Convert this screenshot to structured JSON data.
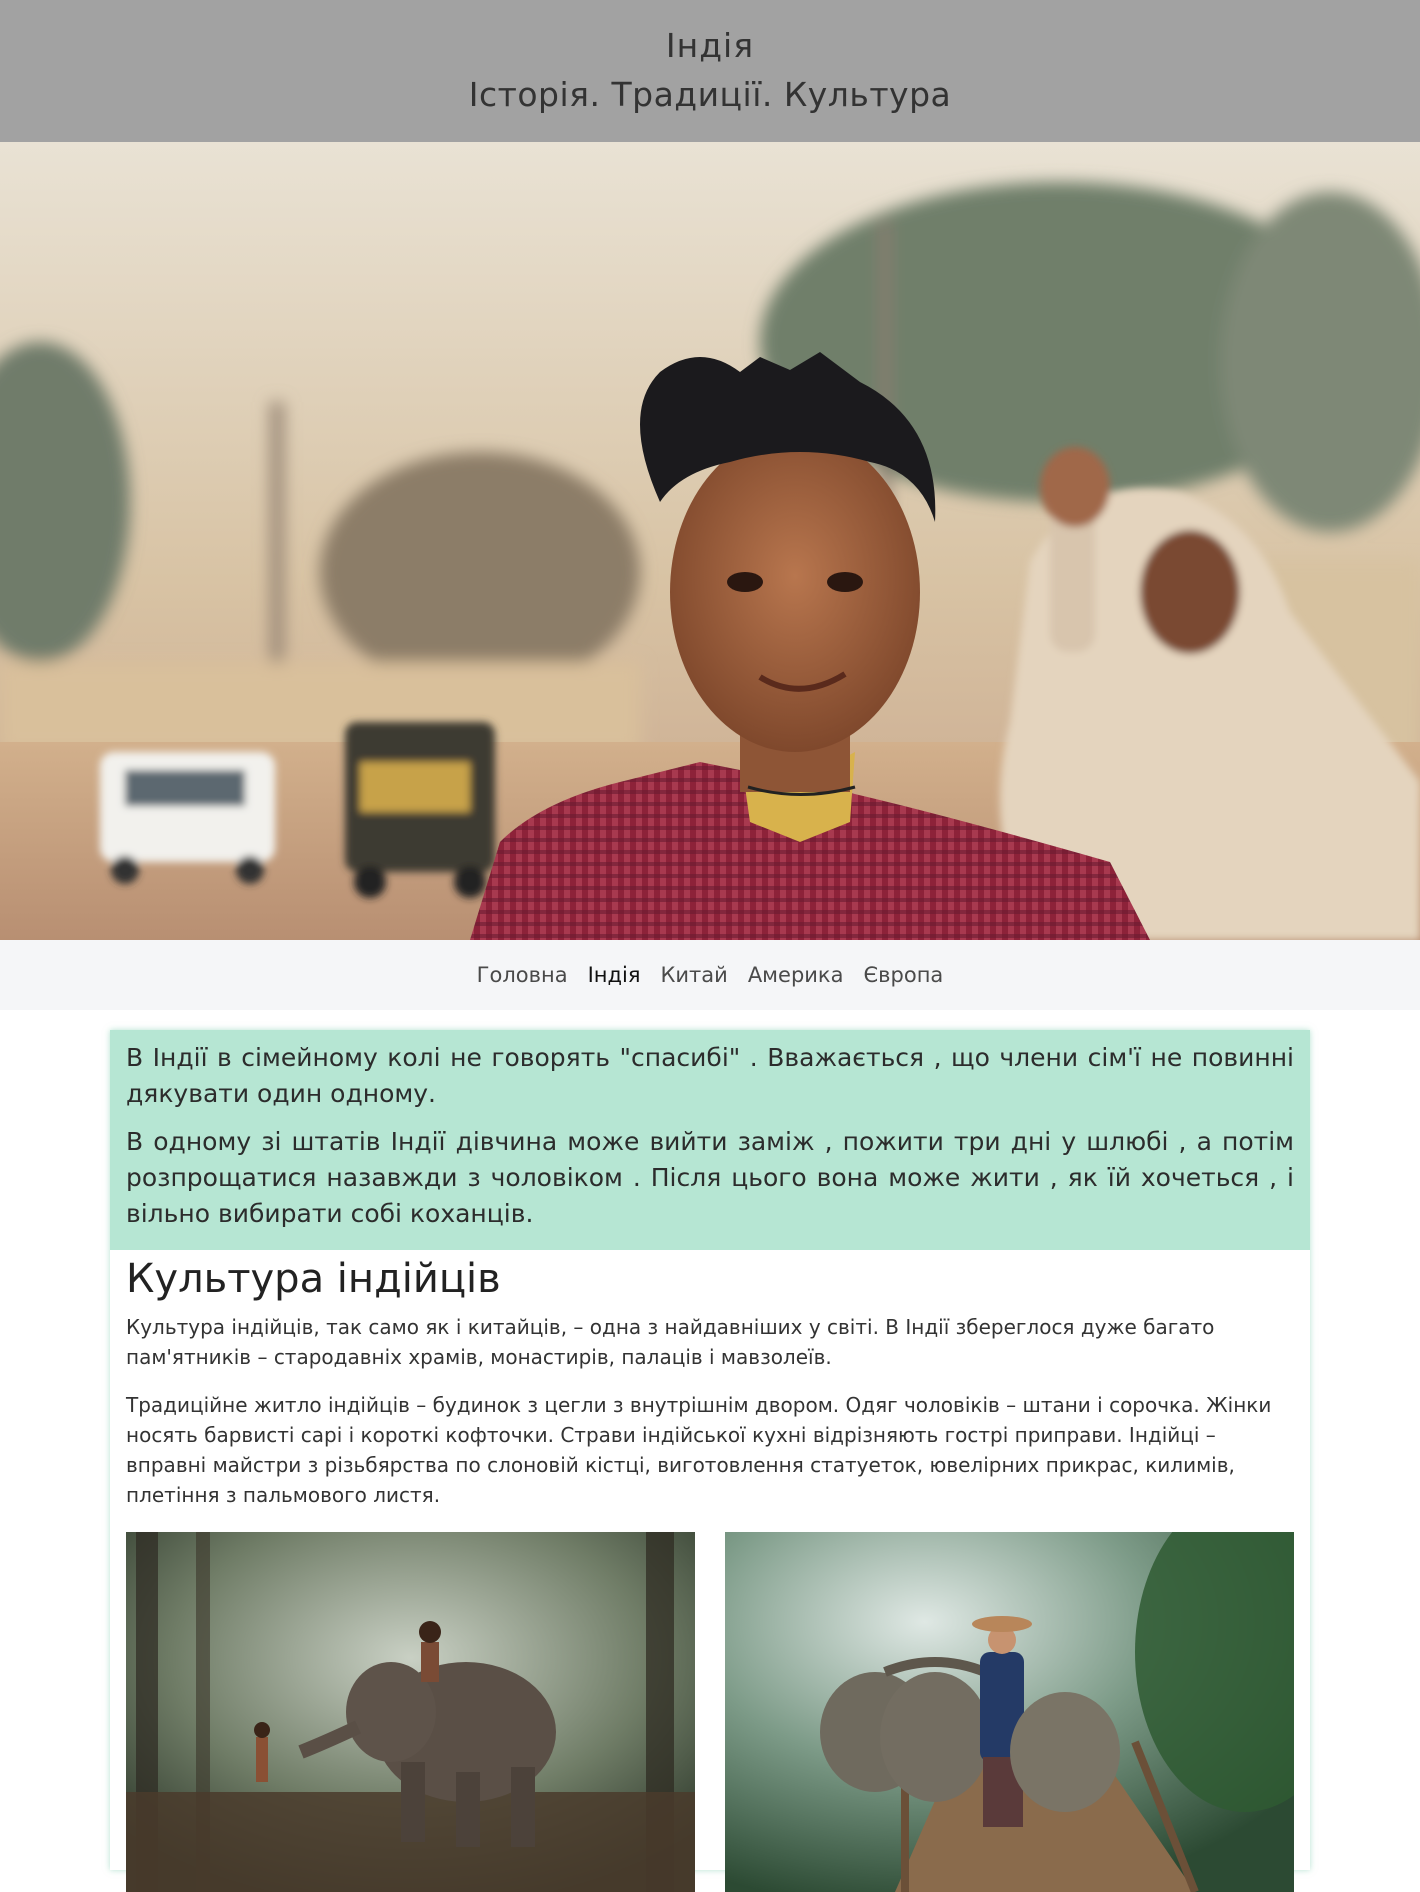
{
  "header": {
    "title": "Індія",
    "subtitle": "Історія. Традиції. Культура"
  },
  "hero": {
    "image": "portrait of smiling boy in red checkered shirt on a dusty street"
  },
  "nav": {
    "items": [
      {
        "label": "Головна",
        "active": false
      },
      {
        "label": "Індія",
        "active": true
      },
      {
        "label": "Китай",
        "active": false
      },
      {
        "label": "Америка",
        "active": false
      },
      {
        "label": "Європа",
        "active": false
      }
    ]
  },
  "facts": {
    "p1": "В Індії в сімейному колі не говорять \"спасибі\" . Вважається , що члени сім'ї не повинні дякувати один одному.",
    "p2": "В одному зі штатів Індії дівчина може вийти заміж , пожити три дні у шлюбі , а потім розпрощатися назавжди з чоловіком . Після цього вона може жити , як їй хочеться , і вільно вибирати собі коханців."
  },
  "culture": {
    "heading": "Культура індійців",
    "p1": "Культура індійців, так само як і китайців, – одна з найдавніших у світі. В Індії збереглося дуже багато пам'ятників – стародавніх храмів, монастирів, палаців і мавзолеїв.",
    "p2": "Традиційне житло індійців – будинок з цегли з внутрішнім двором. Одяг чоловіків – штани і сорочка. Жінки носять барвисті сарі і короткі кофточки. Страви індійської кухні відрізняють гострі приправи. Індійці – вправні майстри з різьбярства по слоновій кістці, виготовлення статуеток, ювелірних прикрас, килимів, плетіння з пальмового листя."
  },
  "photos": [
    {
      "image": "child feeding elephant in misty forest"
    },
    {
      "image": "woman in hat with water buffaloes on wooden bridge"
    }
  ],
  "colors": {
    "header_bg": "#a2a2a2",
    "nav_bg": "#f5f6f8",
    "facts_bg": "#b6e6d3"
  }
}
